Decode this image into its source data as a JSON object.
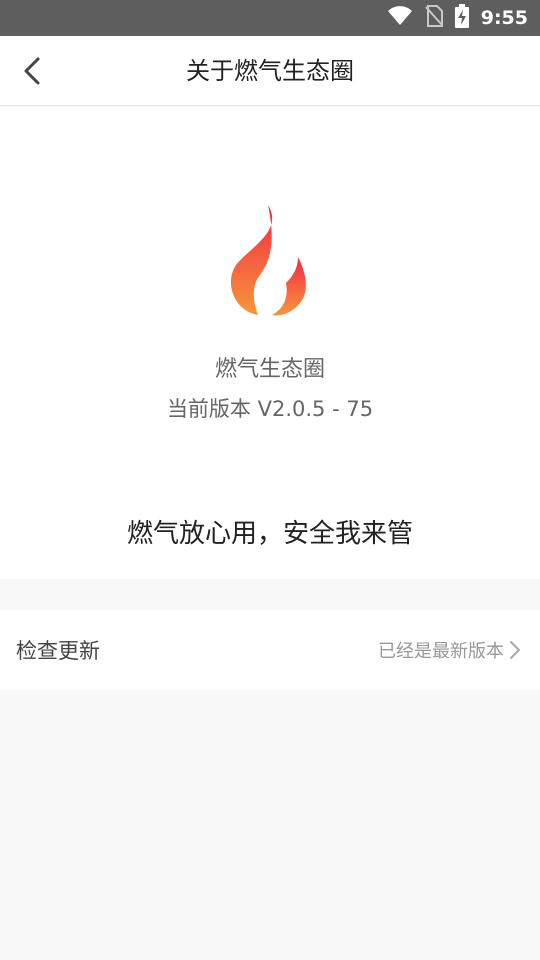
{
  "status_bar": {
    "time": "9:55",
    "icons": [
      "wifi-icon",
      "no-sim-icon",
      "battery-charging-icon"
    ]
  },
  "header": {
    "title": "关于燃气生态圈",
    "back_icon": "chevron-left-icon"
  },
  "about": {
    "logo_icon": "flame-logo-icon",
    "logo_colors": [
      "#ef2a45",
      "#f9963a"
    ],
    "app_name": "燃气生态圈",
    "version": "当前版本 V2.0.5 - 75",
    "slogan": "燃气放心用，安全我来管"
  },
  "check_update": {
    "label": "检查更新",
    "status": "已经是最新版本",
    "chevron_icon": "chevron-right-icon"
  }
}
